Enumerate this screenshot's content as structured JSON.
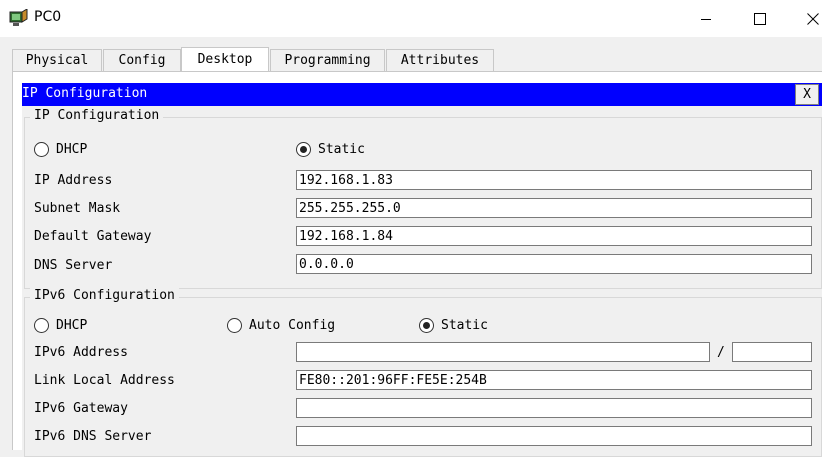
{
  "window": {
    "title": "PC0",
    "minimize_icon": "minimize-icon",
    "maximize_icon": "maximize-icon",
    "close_icon": "close-icon"
  },
  "tabs": [
    {
      "label": "Physical",
      "active": false
    },
    {
      "label": "Config",
      "active": false
    },
    {
      "label": "Desktop",
      "active": true
    },
    {
      "label": "Programming",
      "active": false
    },
    {
      "label": "Attributes",
      "active": false
    }
  ],
  "ip_window": {
    "title": "IP Configuration",
    "close_label": "X",
    "accent_color": "#0000ff"
  },
  "ipv4": {
    "group_label": "IP Configuration",
    "dhcp_label": "DHCP",
    "static_label": "Static",
    "selected": "Static",
    "fields": {
      "ip_address": {
        "label": "IP Address",
        "value": "192.168.1.83"
      },
      "subnet_mask": {
        "label": "Subnet Mask",
        "value": "255.255.255.0"
      },
      "default_gateway": {
        "label": "Default Gateway",
        "value": "192.168.1.84"
      },
      "dns_server": {
        "label": "DNS Server",
        "value": "0.0.0.0"
      }
    }
  },
  "ipv6": {
    "group_label": "IPv6 Configuration",
    "dhcp_label": "DHCP",
    "auto_config_label": "Auto Config",
    "static_label": "Static",
    "selected": "Static",
    "fields": {
      "ipv6_address": {
        "label": "IPv6 Address",
        "value": "",
        "separator": "/",
        "prefix": ""
      },
      "link_local": {
        "label": "Link Local Address",
        "value": "FE80::201:96FF:FE5E:254B"
      },
      "ipv6_gateway": {
        "label": "IPv6 Gateway",
        "value": ""
      },
      "ipv6_dns": {
        "label": "IPv6 DNS Server",
        "value": ""
      }
    }
  }
}
